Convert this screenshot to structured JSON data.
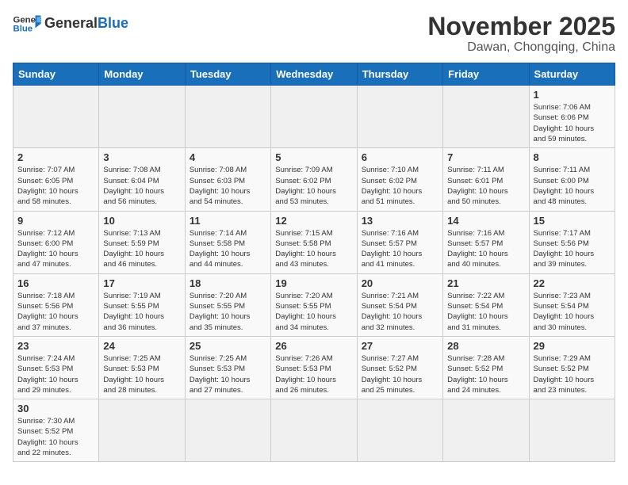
{
  "header": {
    "logo_general": "General",
    "logo_blue": "Blue",
    "month_title": "November 2025",
    "location": "Dawan, Chongqing, China"
  },
  "weekdays": [
    "Sunday",
    "Monday",
    "Tuesday",
    "Wednesday",
    "Thursday",
    "Friday",
    "Saturday"
  ],
  "weeks": [
    [
      {
        "day": "",
        "info": ""
      },
      {
        "day": "",
        "info": ""
      },
      {
        "day": "",
        "info": ""
      },
      {
        "day": "",
        "info": ""
      },
      {
        "day": "",
        "info": ""
      },
      {
        "day": "",
        "info": ""
      },
      {
        "day": "1",
        "info": "Sunrise: 7:06 AM\nSunset: 6:06 PM\nDaylight: 10 hours\nand 59 minutes."
      }
    ],
    [
      {
        "day": "2",
        "info": "Sunrise: 7:07 AM\nSunset: 6:05 PM\nDaylight: 10 hours\nand 58 minutes."
      },
      {
        "day": "3",
        "info": "Sunrise: 7:08 AM\nSunset: 6:04 PM\nDaylight: 10 hours\nand 56 minutes."
      },
      {
        "day": "4",
        "info": "Sunrise: 7:08 AM\nSunset: 6:03 PM\nDaylight: 10 hours\nand 54 minutes."
      },
      {
        "day": "5",
        "info": "Sunrise: 7:09 AM\nSunset: 6:02 PM\nDaylight: 10 hours\nand 53 minutes."
      },
      {
        "day": "6",
        "info": "Sunrise: 7:10 AM\nSunset: 6:02 PM\nDaylight: 10 hours\nand 51 minutes."
      },
      {
        "day": "7",
        "info": "Sunrise: 7:11 AM\nSunset: 6:01 PM\nDaylight: 10 hours\nand 50 minutes."
      },
      {
        "day": "8",
        "info": "Sunrise: 7:11 AM\nSunset: 6:00 PM\nDaylight: 10 hours\nand 48 minutes."
      }
    ],
    [
      {
        "day": "9",
        "info": "Sunrise: 7:12 AM\nSunset: 6:00 PM\nDaylight: 10 hours\nand 47 minutes."
      },
      {
        "day": "10",
        "info": "Sunrise: 7:13 AM\nSunset: 5:59 PM\nDaylight: 10 hours\nand 46 minutes."
      },
      {
        "day": "11",
        "info": "Sunrise: 7:14 AM\nSunset: 5:58 PM\nDaylight: 10 hours\nand 44 minutes."
      },
      {
        "day": "12",
        "info": "Sunrise: 7:15 AM\nSunset: 5:58 PM\nDaylight: 10 hours\nand 43 minutes."
      },
      {
        "day": "13",
        "info": "Sunrise: 7:16 AM\nSunset: 5:57 PM\nDaylight: 10 hours\nand 41 minutes."
      },
      {
        "day": "14",
        "info": "Sunrise: 7:16 AM\nSunset: 5:57 PM\nDaylight: 10 hours\nand 40 minutes."
      },
      {
        "day": "15",
        "info": "Sunrise: 7:17 AM\nSunset: 5:56 PM\nDaylight: 10 hours\nand 39 minutes."
      }
    ],
    [
      {
        "day": "16",
        "info": "Sunrise: 7:18 AM\nSunset: 5:56 PM\nDaylight: 10 hours\nand 37 minutes."
      },
      {
        "day": "17",
        "info": "Sunrise: 7:19 AM\nSunset: 5:55 PM\nDaylight: 10 hours\nand 36 minutes."
      },
      {
        "day": "18",
        "info": "Sunrise: 7:20 AM\nSunset: 5:55 PM\nDaylight: 10 hours\nand 35 minutes."
      },
      {
        "day": "19",
        "info": "Sunrise: 7:20 AM\nSunset: 5:55 PM\nDaylight: 10 hours\nand 34 minutes."
      },
      {
        "day": "20",
        "info": "Sunrise: 7:21 AM\nSunset: 5:54 PM\nDaylight: 10 hours\nand 32 minutes."
      },
      {
        "day": "21",
        "info": "Sunrise: 7:22 AM\nSunset: 5:54 PM\nDaylight: 10 hours\nand 31 minutes."
      },
      {
        "day": "22",
        "info": "Sunrise: 7:23 AM\nSunset: 5:54 PM\nDaylight: 10 hours\nand 30 minutes."
      }
    ],
    [
      {
        "day": "23",
        "info": "Sunrise: 7:24 AM\nSunset: 5:53 PM\nDaylight: 10 hours\nand 29 minutes."
      },
      {
        "day": "24",
        "info": "Sunrise: 7:25 AM\nSunset: 5:53 PM\nDaylight: 10 hours\nand 28 minutes."
      },
      {
        "day": "25",
        "info": "Sunrise: 7:25 AM\nSunset: 5:53 PM\nDaylight: 10 hours\nand 27 minutes."
      },
      {
        "day": "26",
        "info": "Sunrise: 7:26 AM\nSunset: 5:53 PM\nDaylight: 10 hours\nand 26 minutes."
      },
      {
        "day": "27",
        "info": "Sunrise: 7:27 AM\nSunset: 5:52 PM\nDaylight: 10 hours\nand 25 minutes."
      },
      {
        "day": "28",
        "info": "Sunrise: 7:28 AM\nSunset: 5:52 PM\nDaylight: 10 hours\nand 24 minutes."
      },
      {
        "day": "29",
        "info": "Sunrise: 7:29 AM\nSunset: 5:52 PM\nDaylight: 10 hours\nand 23 minutes."
      }
    ],
    [
      {
        "day": "30",
        "info": "Sunrise: 7:30 AM\nSunset: 5:52 PM\nDaylight: 10 hours\nand 22 minutes."
      },
      {
        "day": "",
        "info": ""
      },
      {
        "day": "",
        "info": ""
      },
      {
        "day": "",
        "info": ""
      },
      {
        "day": "",
        "info": ""
      },
      {
        "day": "",
        "info": ""
      },
      {
        "day": "",
        "info": ""
      }
    ]
  ]
}
